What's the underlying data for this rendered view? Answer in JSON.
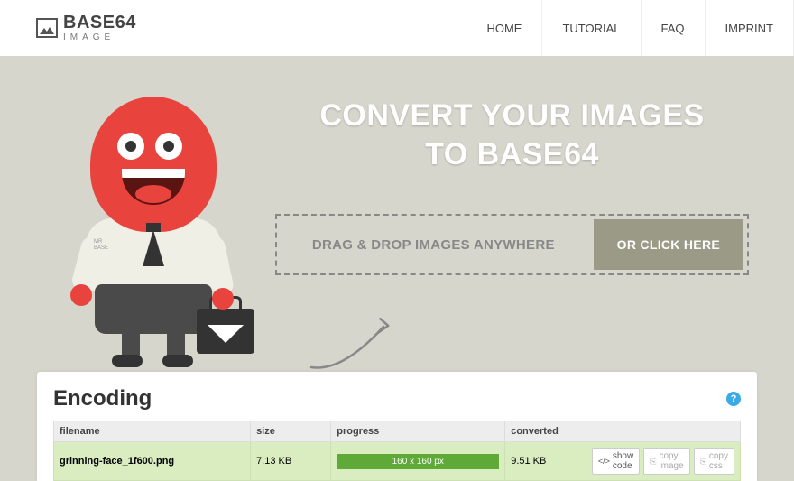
{
  "logo": {
    "main": "BASE64",
    "sub": "IMAGE"
  },
  "nav": {
    "items": [
      "HOME",
      "TUTORIAL",
      "FAQ",
      "IMPRINT"
    ]
  },
  "hero": {
    "title_l1": "CONVERT YOUR IMAGES",
    "title_l2": "TO BASE64",
    "drop_text": "DRAG & DROP IMAGES ANYWHERE",
    "drop_btn": "OR CLICK HERE"
  },
  "mascot": {
    "tag_l1": "MR",
    "tag_l2": "BASE"
  },
  "card": {
    "title": "Encoding",
    "cols": {
      "c0": "filename",
      "c1": "size",
      "c2": "progress",
      "c3": "converted"
    },
    "row": {
      "filename": "grinning-face_1f600.png",
      "size": "7.13 KB",
      "progress": "160 x 160 px",
      "converted": "9.51 KB",
      "btn_show": "show code",
      "btn_img": "copy image",
      "btn_css": "copy css"
    }
  }
}
